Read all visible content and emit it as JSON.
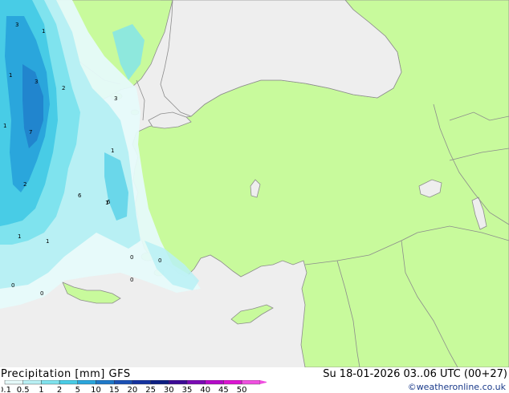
{
  "footer": {
    "title": "Precipitation [mm]  GFS",
    "datetime": "Su 18-01-2026 03..06 UTC (00+27)",
    "credit": "©weatheronline.co.uk"
  },
  "legend": {
    "ticks": [
      "0.1",
      "0.5",
      "1",
      "2",
      "5",
      "10",
      "15",
      "20",
      "25",
      "30",
      "35",
      "40",
      "45",
      "50"
    ],
    "colors": [
      "#e6fafa",
      "#b8f0f4",
      "#7fe3ee",
      "#48cce6",
      "#2aa6dc",
      "#1e78c8",
      "#1a50b4",
      "#1432a0",
      "#0c1e82",
      "#3c0a96",
      "#7a0ab4",
      "#b40ac8",
      "#dc14d2",
      "#f050e0"
    ]
  },
  "colors": {
    "sea": "#eeeeee",
    "land": "#c8fa9c",
    "border": "#8c8c8c"
  },
  "map": {
    "precip_labels": [
      "3",
      "1",
      "1",
      "3",
      "2",
      "3",
      "1",
      "7",
      "1",
      "2",
      "6",
      "1",
      "1",
      "1",
      "6",
      "0",
      "0",
      "0",
      "0",
      "0"
    ]
  }
}
